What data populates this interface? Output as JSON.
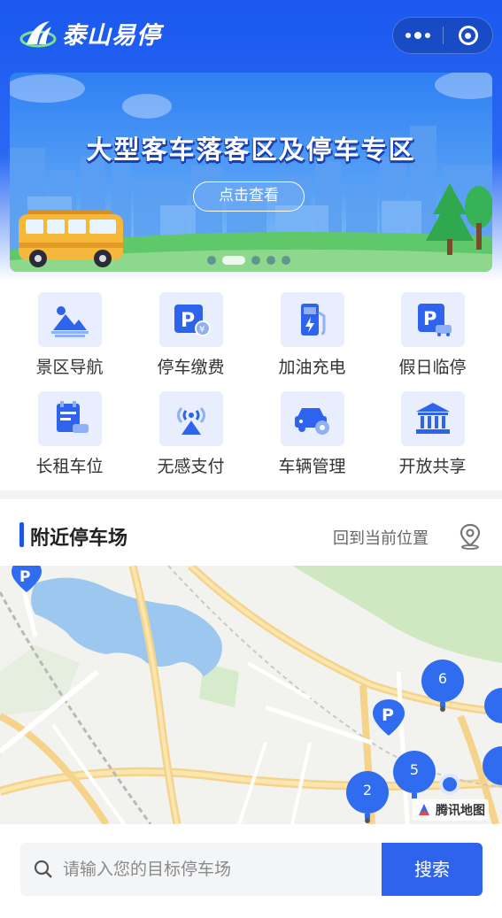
{
  "header": {
    "app_name": "泰山易停",
    "logo_icon": "taishan-logo-icon",
    "capsule": {
      "more_icon": "more-dots-icon",
      "close_icon": "circle-close-icon"
    }
  },
  "banner": {
    "title": "大型客车落客区及停车专区",
    "button_label": "点击查看",
    "slides_count": 5,
    "active_slide": 2
  },
  "menu": {
    "items": [
      {
        "label": "景区导航",
        "icon": "scenic-mountain-icon"
      },
      {
        "label": "停车缴费",
        "icon": "parking-pay-icon"
      },
      {
        "label": "加油充电",
        "icon": "fuel-charge-icon"
      },
      {
        "label": "假日临停",
        "icon": "holiday-parking-icon"
      },
      {
        "label": "长租车位",
        "icon": "long-rent-icon"
      },
      {
        "label": "无感支付",
        "icon": "contactless-pay-icon"
      },
      {
        "label": "车辆管理",
        "icon": "car-manage-icon"
      },
      {
        "label": "开放共享",
        "icon": "open-share-icon"
      }
    ]
  },
  "nearby": {
    "title": "附近停车场",
    "relocate_label": "回到当前位置",
    "relocate_icon": "location-pin-icon"
  },
  "map": {
    "provider_label": "腾讯地图",
    "clusters": [
      "6",
      "5",
      "2"
    ],
    "colors": {
      "marker": "#2f6cf0",
      "water": "#9cc7ee",
      "green": "#cfe8c2",
      "road": "#f5d38a"
    }
  },
  "search": {
    "placeholder": "请输入您的目标停车场",
    "button_label": "搜索"
  },
  "colors": {
    "primary": "#2e63ed",
    "icon_bg": "#e8eefd"
  }
}
